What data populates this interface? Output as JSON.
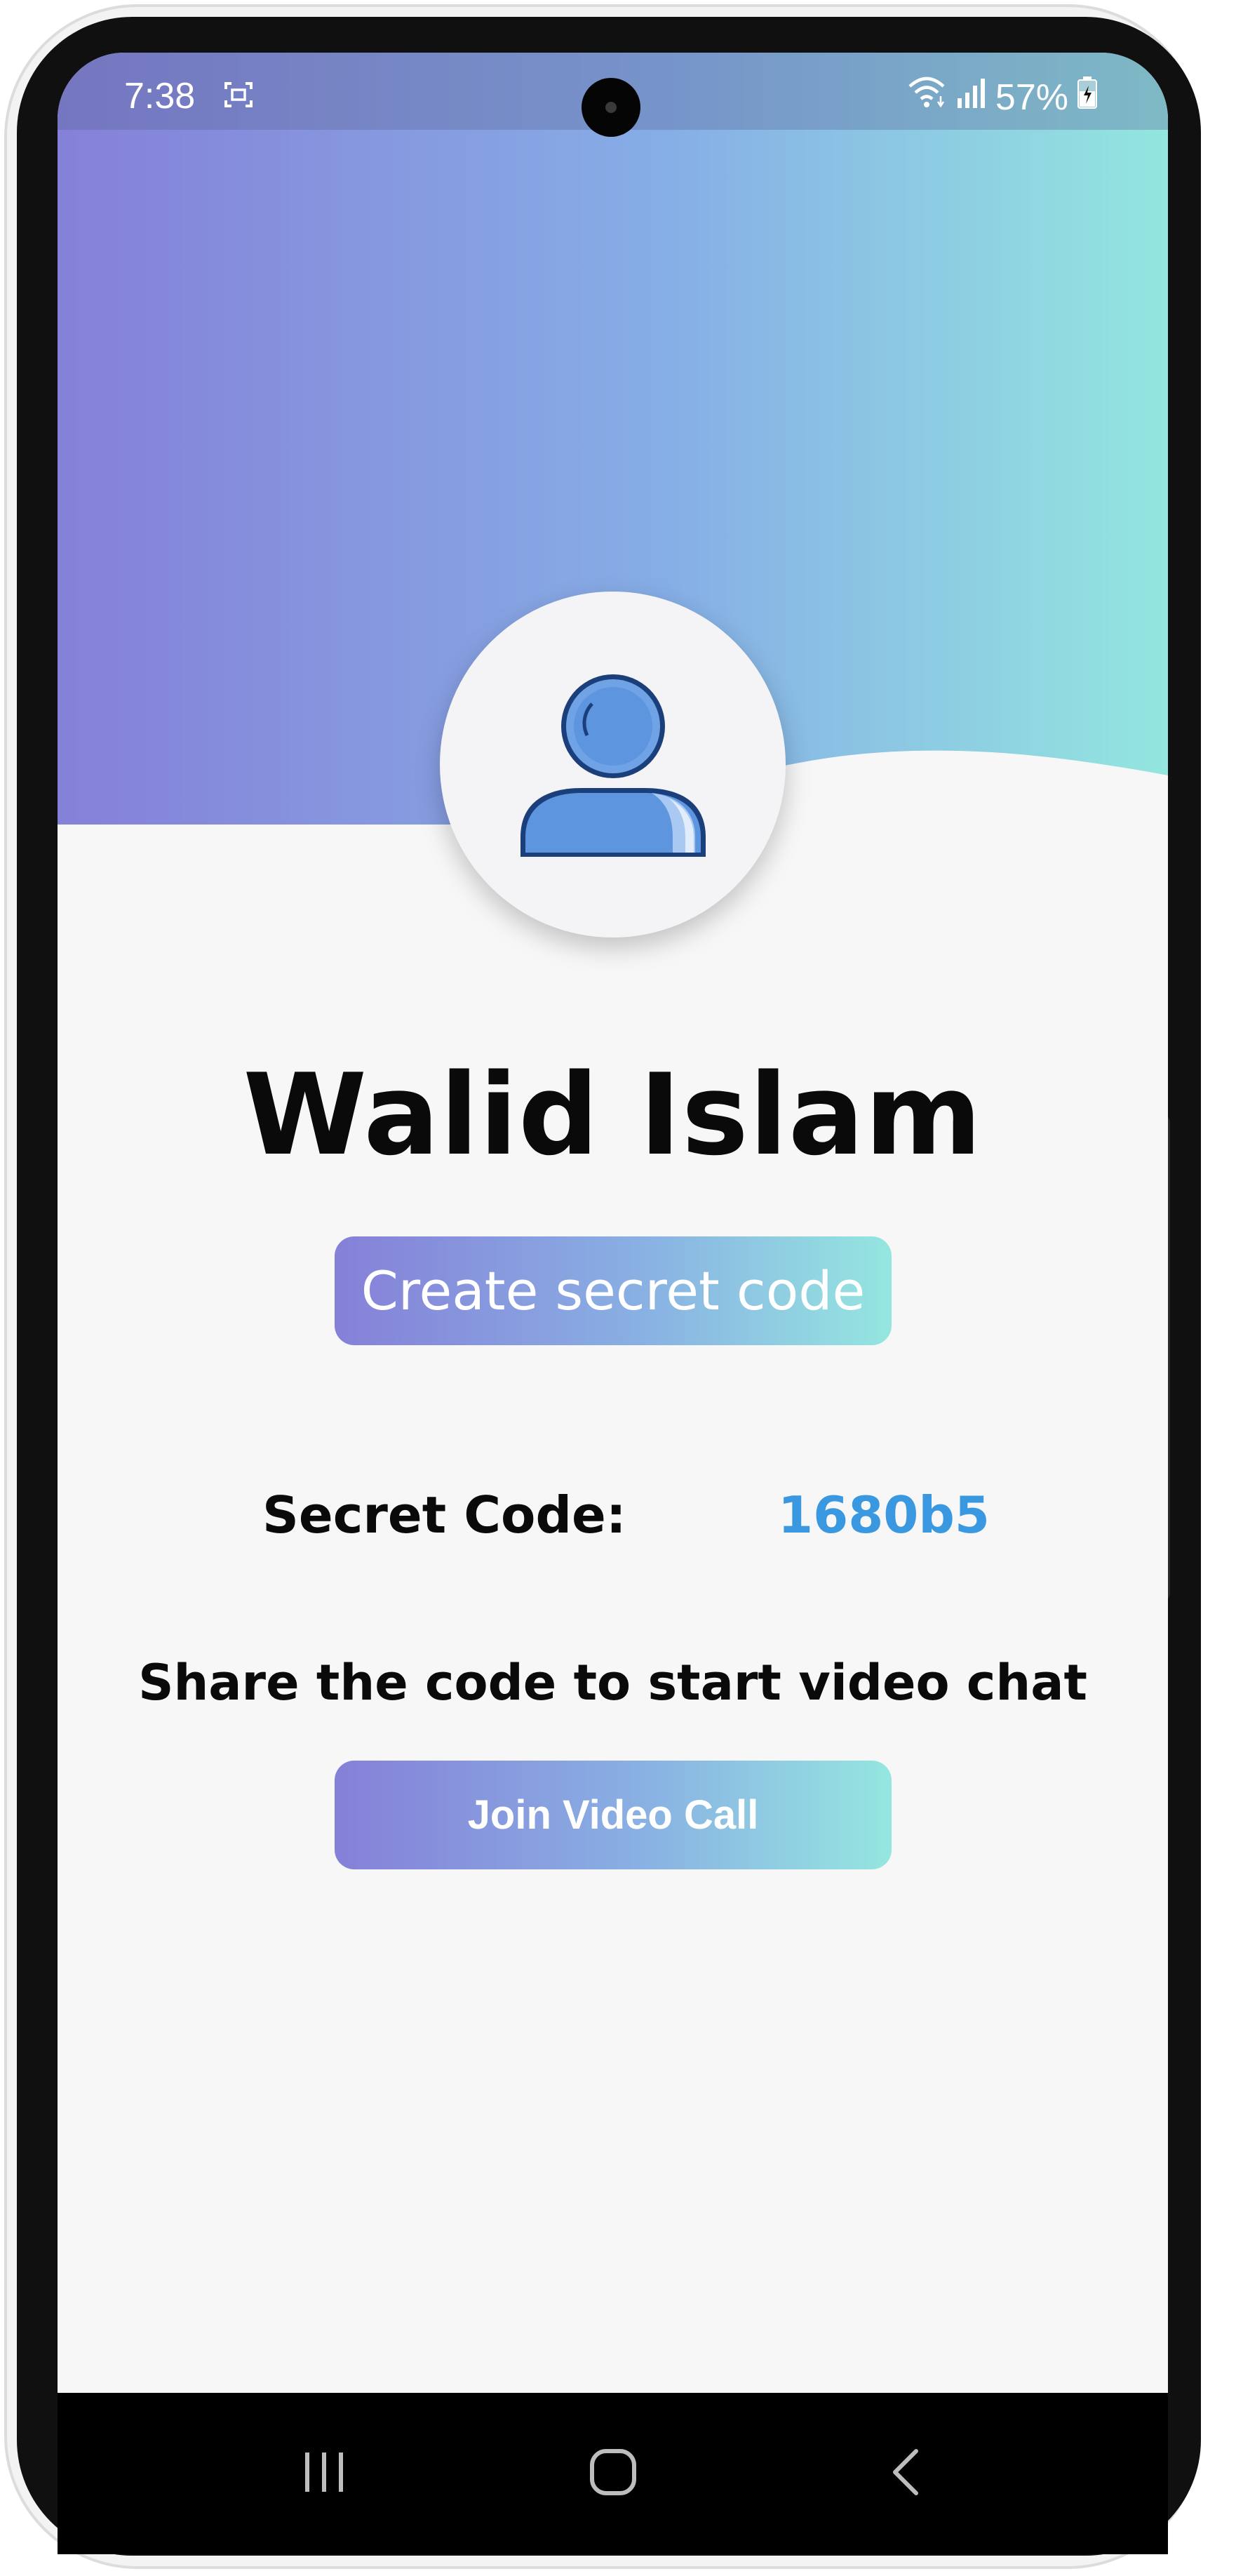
{
  "status_bar": {
    "time": "7:38",
    "battery": "57%",
    "icons": [
      "screenshot-icon",
      "wifi-icon",
      "signal-icon",
      "battery-charging-icon"
    ]
  },
  "profile": {
    "avatar_icon": "user-avatar-icon",
    "name": "Walid Islam"
  },
  "actions": {
    "create_code_label": "Create secret code",
    "join_call_label": "Join Video Call"
  },
  "code": {
    "label": "Secret Code:",
    "value": "1680b5"
  },
  "instructions": "Share the code to start video chat",
  "nav": {
    "icons": [
      "recent-apps-icon",
      "home-icon",
      "back-icon"
    ]
  },
  "colors": {
    "gradient_start": "#8580d8",
    "gradient_mid": "#89b0e3",
    "gradient_end": "#95e6e0",
    "code_value": "#3a98e0",
    "background": "#f7f7f8"
  }
}
